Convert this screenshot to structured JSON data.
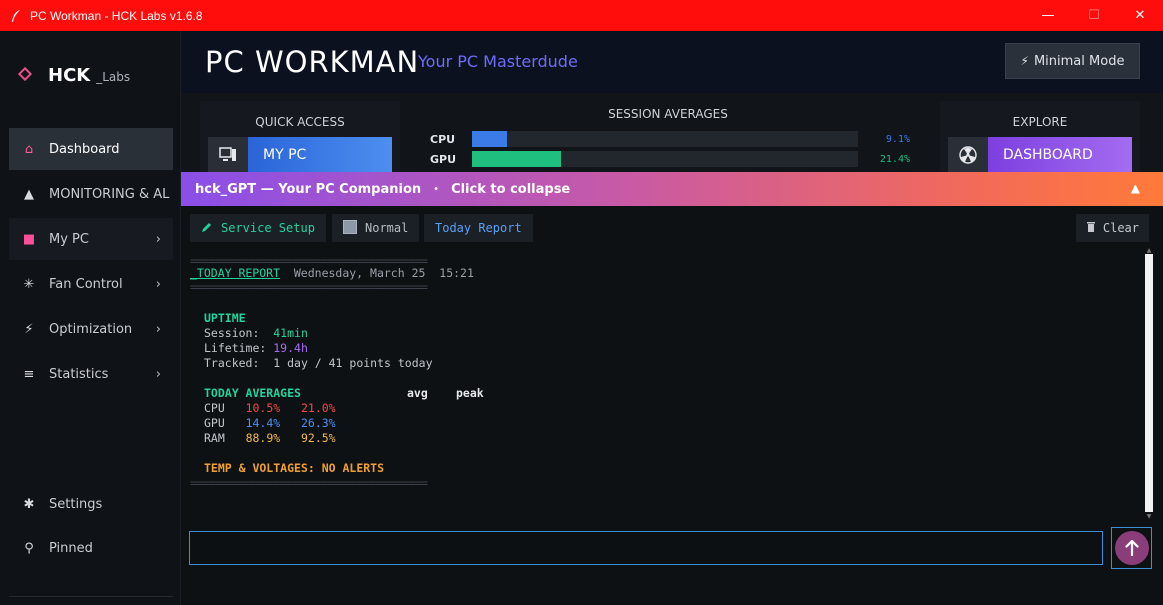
{
  "window": {
    "title": "PC Workman - HCK Labs v1.6.8",
    "controls": {
      "minimize": "—",
      "maximize": "☐",
      "close": "✕"
    }
  },
  "sidebar": {
    "logo": {
      "main": "HCK",
      "sub": "_Labs"
    },
    "items": [
      {
        "label": "Dashboard",
        "icon": "home-icon",
        "glyph": "⌂",
        "chevron": ""
      },
      {
        "label": "MONITORING & AL",
        "icon": "warning-icon",
        "glyph": "▲",
        "chevron": ""
      },
      {
        "label": "My PC",
        "icon": "square-icon",
        "glyph": "■",
        "chevron": "›"
      },
      {
        "label": "Fan Control",
        "icon": "fan-icon",
        "glyph": "✳",
        "chevron": "›"
      },
      {
        "label": "Optimization",
        "icon": "lightning-icon",
        "glyph": "⚡",
        "chevron": "›"
      },
      {
        "label": "Statistics",
        "icon": "list-icon",
        "glyph": "≡",
        "chevron": "›"
      },
      {
        "label": "Settings",
        "icon": "gear-icon",
        "glyph": "✱",
        "chevron": ""
      },
      {
        "label": "Pinned",
        "icon": "pin-icon",
        "glyph": "⚲",
        "chevron": ""
      }
    ]
  },
  "header": {
    "brand": "PC  WORKMAN",
    "tagline": "Your PC Masterdude",
    "minimal_mode_label": "Minimal Mode"
  },
  "quick_access": {
    "title": "QUICK ACCESS",
    "card_label": "MY PC"
  },
  "session_averages": {
    "title": "SESSION AVERAGES",
    "rows": [
      {
        "label": "CPU",
        "value_text": "9.1%",
        "fraction": 0.091,
        "color": "#3b7be8"
      },
      {
        "label": "GPU",
        "value_text": "21.4%",
        "fraction": 0.23,
        "color": "#1fbf7f"
      }
    ]
  },
  "explore": {
    "title": "EXPLORE",
    "card_label": "DASHBOARD"
  },
  "gpt_banner": {
    "title": "hck_GPT — Your PC Companion",
    "separator": "•",
    "action": "Click to collapse",
    "caret": "▲"
  },
  "toolbar": {
    "service_setup": "Service Setup",
    "normal": "Normal",
    "today_report": "Today Report",
    "clear": "Clear"
  },
  "report": {
    "separator": "========================================",
    "heading": "_TODAY REPORT",
    "date": "Wednesday, March 25  15:21",
    "uptime_title": "UPTIME",
    "session_label": "Session:",
    "session_value": "41min",
    "lifetime_label": "Lifetime:",
    "lifetime_value": "19.4h",
    "tracked_label": "Tracked:",
    "tracked_value": "1 day / 41 points today",
    "averages_title": "TODAY AVERAGES",
    "col_avg": "avg",
    "col_peak": "peak",
    "rows": [
      {
        "label": "CPU",
        "avg": "10.5%",
        "peak": "21.0%",
        "color": "#ef4a4a"
      },
      {
        "label": "GPU",
        "avg": "14.4%",
        "peak": "26.3%",
        "color": "#4a8ff0"
      },
      {
        "label": "RAM",
        "avg": "88.9%",
        "peak": "92.5%",
        "color": "#f0b94a"
      }
    ],
    "alerts": "TEMP & VOLTAGES: NO ALERTS"
  },
  "chat_input": {
    "value": "",
    "placeholder": ""
  },
  "colors": {
    "accent_green": "#22d39a",
    "accent_orange": "#f0a030",
    "accent_purple": "#a66cf0"
  }
}
